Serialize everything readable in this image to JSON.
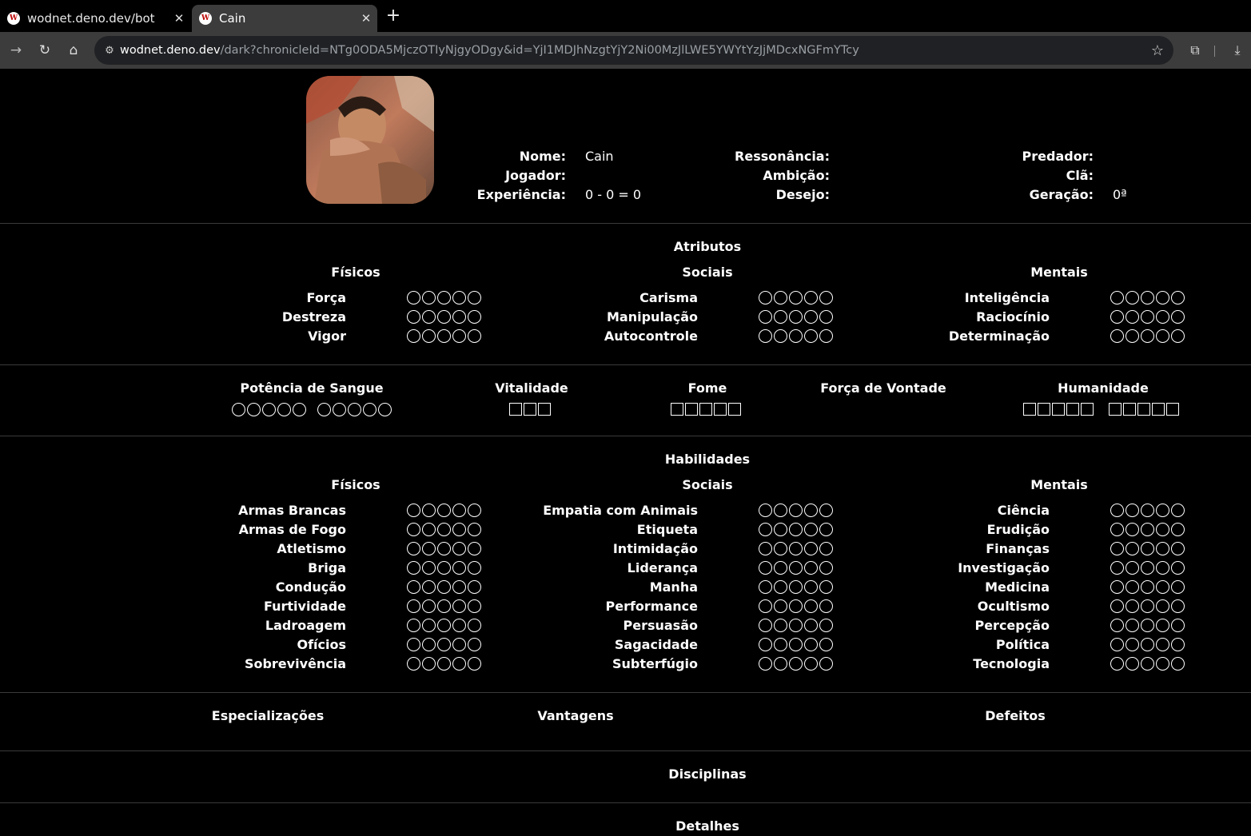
{
  "browser": {
    "tabs": [
      {
        "title": "wodnet.deno.dev/bot",
        "active": false
      },
      {
        "title": "Cain",
        "active": true
      }
    ],
    "url_host": "wodnet.deno.dev",
    "url_path": "/dark?chronicleId=NTg0ODA5MjczOTIyNjgyODgy&id=YjI1MDJhNzgtYjY2Ni00MzJlLWE5YWYtYzJjMDcxNGFmYTcy"
  },
  "header": {
    "col1": [
      {
        "label": "Nome:",
        "value": "Cain"
      },
      {
        "label": "Jogador:",
        "value": ""
      },
      {
        "label": "Experiência:",
        "value": "0 - 0 = 0"
      }
    ],
    "col2": [
      {
        "label": "Ressonância:",
        "value": ""
      },
      {
        "label": "Ambição:",
        "value": ""
      },
      {
        "label": "Desejo:",
        "value": ""
      }
    ],
    "col3": [
      {
        "label": "Predador:",
        "value": ""
      },
      {
        "label": "Clã:",
        "value": ""
      },
      {
        "label": "Geração:",
        "value": "0ª"
      }
    ]
  },
  "attributes": {
    "title": "Atributos",
    "groups": [
      {
        "title": "Físicos",
        "items": [
          {
            "label": "Força",
            "value": 0
          },
          {
            "label": "Destreza",
            "value": 0
          },
          {
            "label": "Vigor",
            "value": 0
          }
        ]
      },
      {
        "title": "Sociais",
        "items": [
          {
            "label": "Carisma",
            "value": 0
          },
          {
            "label": "Manipulação",
            "value": 0
          },
          {
            "label": "Autocontrole",
            "value": 0
          }
        ]
      },
      {
        "title": "Mentais",
        "items": [
          {
            "label": "Inteligência",
            "value": 0
          },
          {
            "label": "Raciocínio",
            "value": 0
          },
          {
            "label": "Determinação",
            "value": 0
          }
        ]
      }
    ]
  },
  "trackers": {
    "blood_potency": {
      "label": "Potência de Sangue",
      "value": 0,
      "max": 10
    },
    "health": {
      "label": "Vitalidade",
      "boxes": 3
    },
    "hunger": {
      "label": "Fome",
      "boxes": 5
    },
    "willpower": {
      "label": "Força de Vontade",
      "boxes": 0
    },
    "humanity": {
      "label": "Humanidade",
      "boxes": 10
    }
  },
  "skills": {
    "title": "Habilidades",
    "groups": [
      {
        "title": "Físicos",
        "items": [
          {
            "label": "Armas Brancas",
            "value": 0
          },
          {
            "label": "Armas de Fogo",
            "value": 0
          },
          {
            "label": "Atletismo",
            "value": 0
          },
          {
            "label": "Briga",
            "value": 0
          },
          {
            "label": "Condução",
            "value": 0
          },
          {
            "label": "Furtividade",
            "value": 0
          },
          {
            "label": "Ladroagem",
            "value": 0
          },
          {
            "label": "Ofícios",
            "value": 0
          },
          {
            "label": "Sobrevivência",
            "value": 0
          }
        ]
      },
      {
        "title": "Sociais",
        "items": [
          {
            "label": "Empatia com Animais",
            "value": 0
          },
          {
            "label": "Etiqueta",
            "value": 0
          },
          {
            "label": "Intimidação",
            "value": 0
          },
          {
            "label": "Liderança",
            "value": 0
          },
          {
            "label": "Manha",
            "value": 0
          },
          {
            "label": "Performance",
            "value": 0
          },
          {
            "label": "Persuasão",
            "value": 0
          },
          {
            "label": "Sagacidade",
            "value": 0
          },
          {
            "label": "Subterfúgio",
            "value": 0
          }
        ]
      },
      {
        "title": "Mentais",
        "items": [
          {
            "label": "Ciência",
            "value": 0
          },
          {
            "label": "Erudição",
            "value": 0
          },
          {
            "label": "Finanças",
            "value": 0
          },
          {
            "label": "Investigação",
            "value": 0
          },
          {
            "label": "Medicina",
            "value": 0
          },
          {
            "label": "Ocultismo",
            "value": 0
          },
          {
            "label": "Percepção",
            "value": 0
          },
          {
            "label": "Política",
            "value": 0
          },
          {
            "label": "Tecnologia",
            "value": 0
          }
        ]
      }
    ]
  },
  "extras": {
    "specializations": "Especializações",
    "advantages": "Vantagens",
    "flaws": "Defeitos"
  },
  "disciplines": "Disciplinas",
  "details": "Detalhes",
  "colors": {
    "background": "#000000",
    "text": "#ffffff",
    "divider": "#3a3a3a",
    "toolbar": "#3c3c3c"
  }
}
